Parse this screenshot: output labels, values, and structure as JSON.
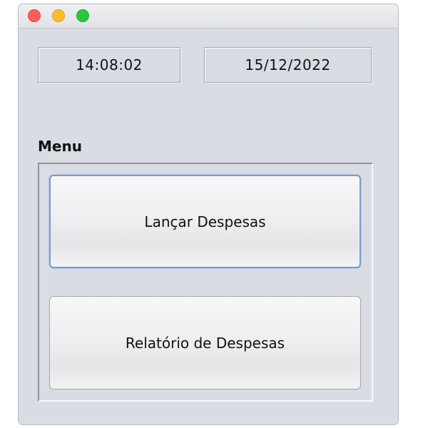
{
  "window": {
    "controls": [
      "close-icon",
      "minimize-icon",
      "maximize-icon"
    ],
    "colors": {
      "close": "#fe5f57",
      "minimize": "#febc2e",
      "maximize": "#28c840",
      "background": "#d9dce3"
    }
  },
  "header": {
    "time": "14:08:02",
    "date": "15/12/2022"
  },
  "menu": {
    "title": "Menu",
    "buttons": [
      {
        "label": "Lançar Despesas",
        "focused": true
      },
      {
        "label": "Relatório de Despesas",
        "focused": false
      }
    ]
  }
}
